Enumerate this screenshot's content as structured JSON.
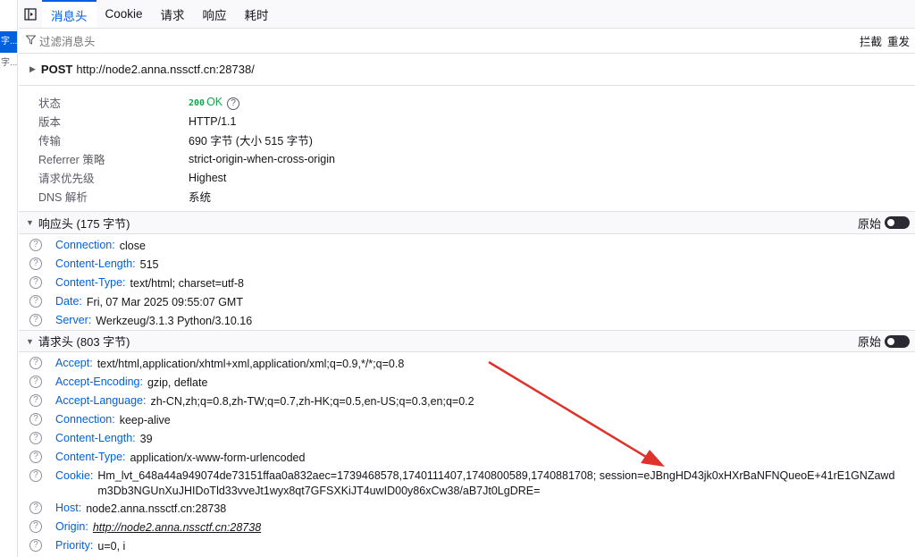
{
  "left_items": [
    "字...",
    "字..."
  ],
  "tabs": [
    "消息头",
    "Cookie",
    "请求",
    "响应",
    "耗时"
  ],
  "filter": {
    "placeholder": "过滤消息头",
    "block_label": "拦截",
    "resend_label": "重发"
  },
  "request": {
    "method": "POST",
    "url": "http://node2.anna.nssctf.cn:28738/"
  },
  "summary": {
    "status_label": "状态",
    "status_code": "200",
    "status_text": "OK",
    "version_label": "版本",
    "version_value": "HTTP/1.1",
    "transfer_label": "传输",
    "transfer_value": "690 字节 (大小 515 字节)",
    "referrer_label": "Referrer 策略",
    "referrer_value": "strict-origin-when-cross-origin",
    "priority_label": "请求优先级",
    "priority_value": "Highest",
    "dns_label": "DNS 解析",
    "dns_value": "系统"
  },
  "response_section": {
    "title": "响应头 (175 字节)",
    "raw_label": "原始"
  },
  "response_headers": [
    {
      "name": "Connection:",
      "value": "close"
    },
    {
      "name": "Content-Length:",
      "value": "515"
    },
    {
      "name": "Content-Type:",
      "value": "text/html; charset=utf-8"
    },
    {
      "name": "Date:",
      "value": "Fri, 07 Mar 2025 09:55:07 GMT"
    },
    {
      "name": "Server:",
      "value": "Werkzeug/3.1.3 Python/3.10.16"
    }
  ],
  "request_section": {
    "title": "请求头 (803 字节)",
    "raw_label": "原始"
  },
  "request_headers": [
    {
      "name": "Accept:",
      "value": "text/html,application/xhtml+xml,application/xml;q=0.9,*/*;q=0.8"
    },
    {
      "name": "Accept-Encoding:",
      "value": "gzip, deflate"
    },
    {
      "name": "Accept-Language:",
      "value": "zh-CN,zh;q=0.8,zh-TW;q=0.7,zh-HK;q=0.5,en-US;q=0.3,en;q=0.2"
    },
    {
      "name": "Connection:",
      "value": "keep-alive"
    },
    {
      "name": "Content-Length:",
      "value": "39"
    },
    {
      "name": "Content-Type:",
      "value": "application/x-www-form-urlencoded"
    },
    {
      "name": "Cookie:",
      "value": "Hm_lvt_648a44a949074de73151ffaa0a832aec=1739468578,1740111407,1740800589,1740881708; session=eJBngHD43jk0xHXrBaNFNQueoE+41rE1GNZawdm3Db3NGUnXuJHIDoTld33vveJt1wyx8qt7GFSXKiJT4uwID00y86xCw38/aB7Jt0LgDRE="
    },
    {
      "name": "Host:",
      "value": "node2.anna.nssctf.cn:28738"
    },
    {
      "name": "Origin:",
      "value": "http://node2.anna.nssctf.cn:28738"
    },
    {
      "name": "Priority:",
      "value": "u=0, i"
    }
  ],
  "icons": {
    "sidebar_toggle": "sidebar-toggle-icon",
    "filter": "filter-icon",
    "help": "question-mark-icon",
    "twisty": "triangle-icon"
  },
  "colors": {
    "accent": "#0060df",
    "status_ok": "#12a34a",
    "annotation_arrow": "#e0322d"
  }
}
